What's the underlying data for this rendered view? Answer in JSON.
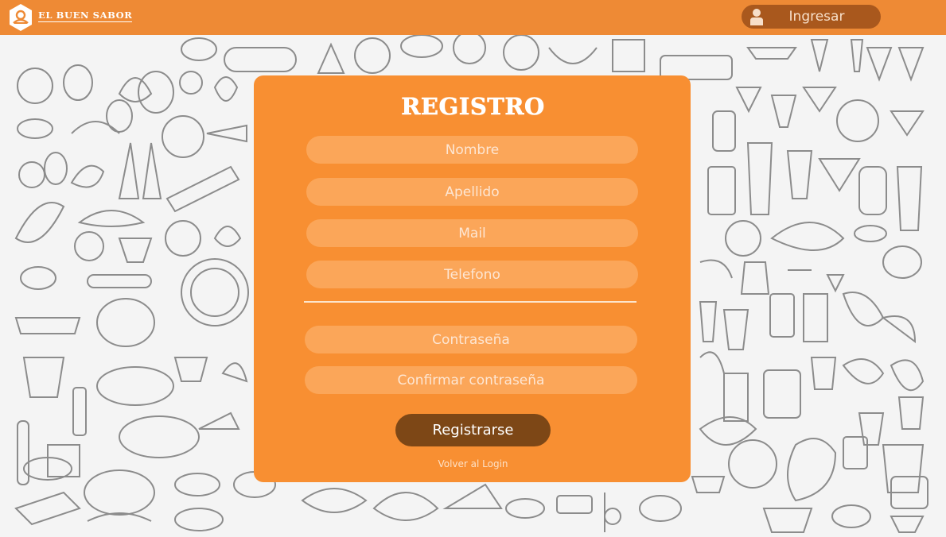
{
  "header": {
    "logo_text": "EL BUEN SABOR",
    "login_label": "Ingresar"
  },
  "form": {
    "title": "REGISTRO",
    "fields": [
      {
        "placeholder": "Nombre"
      },
      {
        "placeholder": "Apellido"
      },
      {
        "placeholder": "Mail"
      },
      {
        "placeholder": "Telefono"
      },
      {
        "placeholder": "Contraseña"
      },
      {
        "placeholder": "Confirmar contraseña"
      }
    ],
    "submit_label": "Registrarse",
    "back_link": "Volver al Login"
  },
  "colors": {
    "header_bg": "#ee8a35",
    "card_bg": "#f88f32",
    "field_bg": "#fba659",
    "submit_bg": "#7d4716",
    "login_btn_bg": "#a9581d"
  },
  "icons": {
    "logo": "chef-hat-logo-icon",
    "user": "user-icon"
  }
}
